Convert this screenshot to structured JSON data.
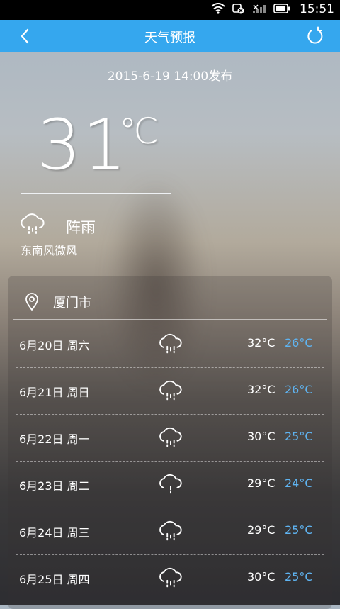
{
  "status_bar": {
    "time": "15:51",
    "icons": [
      "wifi-icon",
      "sync-off-icon",
      "signal-icon",
      "battery-icon"
    ]
  },
  "app_bar": {
    "title": "天气预报",
    "back_icon": "chevron-left-icon",
    "refresh_icon": "refresh-icon"
  },
  "current": {
    "published": "2015-6-19 14:00发布",
    "temperature": "31",
    "unit": "℃",
    "condition_icon": "rain-cloud-icon",
    "condition": "阵雨",
    "wind": "东南风微风"
  },
  "forecast": {
    "city_icon": "location-pin-icon",
    "city": "厦门市",
    "days": [
      {
        "date": "6月20日 周六",
        "icon": "rain-cloud-icon",
        "high": "32°C",
        "low": "26°C"
      },
      {
        "date": "6月21日 周日",
        "icon": "rain-cloud-icon",
        "high": "32°C",
        "low": "26°C"
      },
      {
        "date": "6月22日 周一",
        "icon": "rain-cloud-icon",
        "high": "30°C",
        "low": "25°C"
      },
      {
        "date": "6月23日 周二",
        "icon": "light-rain-cloud-icon",
        "high": "29°C",
        "low": "24°C"
      },
      {
        "date": "6月24日 周三",
        "icon": "rain-cloud-icon",
        "high": "29°C",
        "low": "25°C"
      },
      {
        "date": "6月25日 周四",
        "icon": "rain-cloud-icon",
        "high": "30°C",
        "low": "25°C"
      }
    ]
  },
  "colors": {
    "app_bar": "#35a7ee",
    "low_temp": "#5fb4f2"
  }
}
